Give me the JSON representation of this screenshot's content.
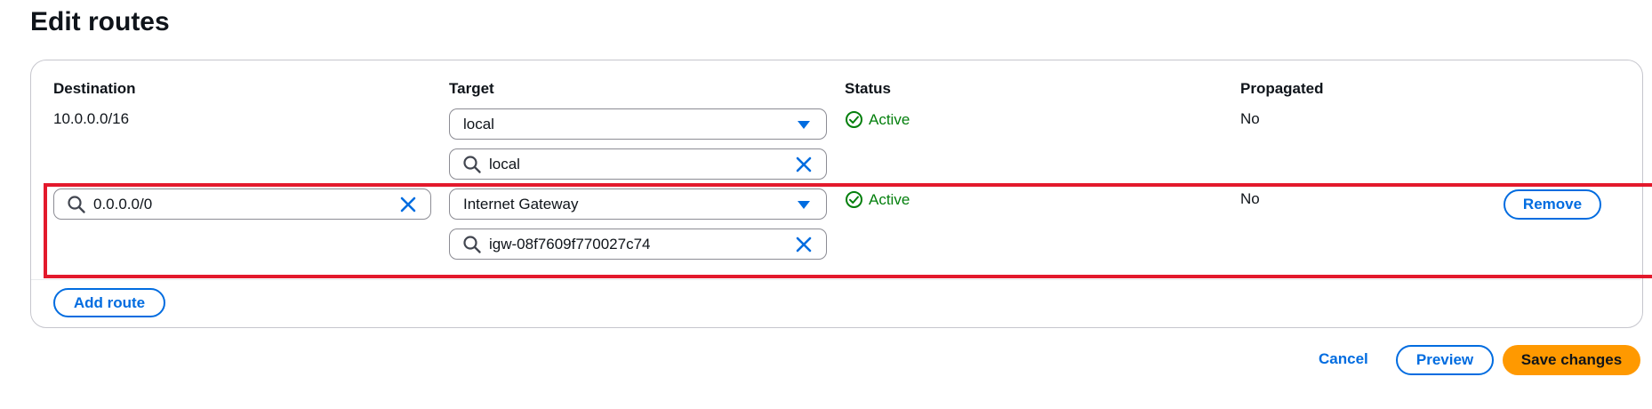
{
  "page": {
    "title": "Edit routes"
  },
  "table": {
    "headers": {
      "destination": "Destination",
      "target": "Target",
      "status": "Status",
      "propagated": "Propagated"
    },
    "rows": [
      {
        "destination": "10.0.0.0/16",
        "target_type": "local",
        "target_value": "local",
        "status": "Active",
        "propagated": "No"
      },
      {
        "destination": "0.0.0.0/0",
        "target_type": "Internet Gateway",
        "target_value": "igw-08f7609f770027c74",
        "status": "Active",
        "propagated": "No",
        "remove_label": "Remove"
      }
    ],
    "add_route_label": "Add route"
  },
  "footer": {
    "cancel_label": "Cancel",
    "preview_label": "Preview",
    "save_label": "Save changes"
  },
  "colors": {
    "accent": "#006ce0",
    "status_active": "#037f0c",
    "primary_button": "#ff9900",
    "highlight": "#e3192c"
  },
  "icons": [
    "search-icon",
    "close-icon",
    "caret-down-icon",
    "check-circle-icon"
  ]
}
